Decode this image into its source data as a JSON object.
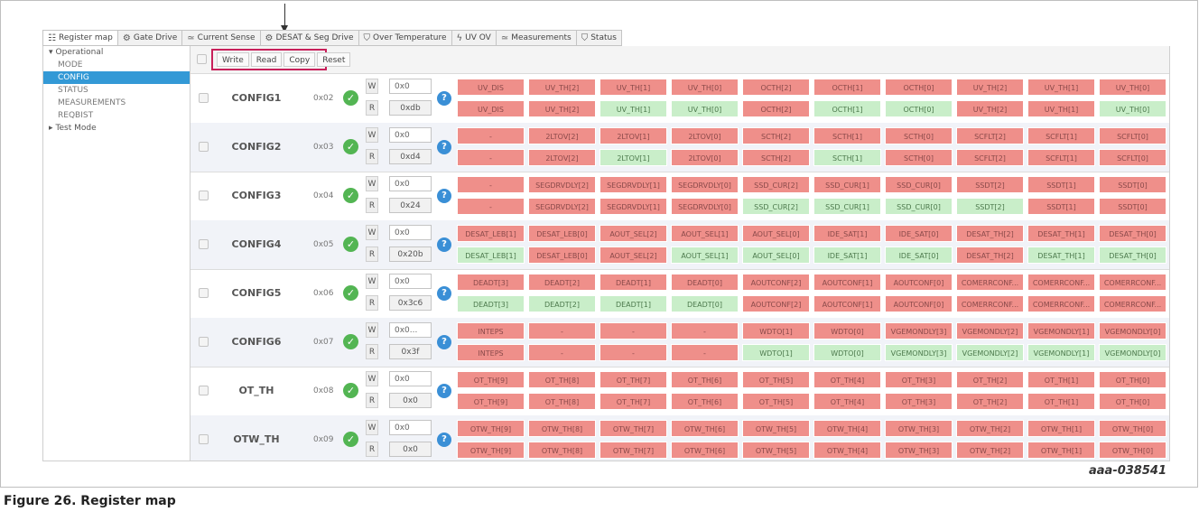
{
  "tabs": [
    {
      "label": "Register map",
      "icon": "register-map-icon",
      "glyph": "☷"
    },
    {
      "label": "Gate Drive",
      "icon": "gear-icon",
      "glyph": "⚙"
    },
    {
      "label": "Current Sense",
      "icon": "chart-icon",
      "glyph": "≃"
    },
    {
      "label": "DESAT & Seg Drive",
      "icon": "gear-icon",
      "glyph": "⚙"
    },
    {
      "label": "Over Temperature",
      "icon": "shield-icon",
      "glyph": "⛉"
    },
    {
      "label": "UV OV",
      "icon": "bolt-icon",
      "glyph": "ϟ"
    },
    {
      "label": "Measurements",
      "icon": "chart-icon",
      "glyph": "≃"
    },
    {
      "label": "Status",
      "icon": "shield-icon",
      "glyph": "⛉"
    }
  ],
  "tree": {
    "groups": [
      {
        "label": "Operational",
        "expanded": true,
        "toggle": "▾",
        "children": [
          {
            "label": "MODE",
            "selected": false
          },
          {
            "label": "CONFIG",
            "selected": true
          },
          {
            "label": "STATUS",
            "selected": false
          },
          {
            "label": "MEASUREMENTS",
            "selected": false
          },
          {
            "label": "REQBIST",
            "selected": false
          }
        ]
      },
      {
        "label": "Test Mode",
        "expanded": false,
        "toggle": "▸",
        "children": []
      }
    ]
  },
  "toolbar": {
    "write": "Write",
    "read": "Read",
    "copy": "Copy",
    "reset": "Reset"
  },
  "labels": {
    "w": "W",
    "r": "R",
    "check_glyph": "✓",
    "help_glyph": "?"
  },
  "registers": [
    {
      "name": "CONFIG1",
      "addr": "0x02",
      "wval": "0x0",
      "rval": "0xdb",
      "bits": [
        "UV_DIS",
        "UV_TH[2]",
        "UV_TH[1]",
        "UV_TH[0]",
        "OCTH[2]",
        "OCTH[1]",
        "OCTH[0]",
        "UV_TH[2]",
        "UV_TH[1]",
        "UV_TH[0]"
      ],
      "rbits": [
        "UV_DIS",
        "UV_TH[2]",
        "UV_TH[1]",
        "UV_TH[0]",
        "OCTH[2]",
        "OCTH[1]",
        "OCTH[0]",
        "UV_TH[2]",
        "UV_TH[1]",
        "UV_TH[0]"
      ],
      "rstate": [
        "red",
        "red",
        "green",
        "green",
        "red",
        "green",
        "green",
        "red",
        "red",
        "green"
      ]
    },
    {
      "name": "CONFIG2",
      "addr": "0x03",
      "wval": "0x0",
      "rval": "0xd4",
      "bits": [
        "-",
        "2LTOV[2]",
        "2LTOV[1]",
        "2LTOV[0]",
        "SCTH[2]",
        "SCTH[1]",
        "SCTH[0]",
        "SCFLT[2]",
        "SCFLT[1]",
        "SCFLT[0]"
      ],
      "rbits": [
        "-",
        "2LTOV[2]",
        "2LTOV[1]",
        "2LTOV[0]",
        "SCTH[2]",
        "SCTH[1]",
        "SCTH[0]",
        "SCFLT[2]",
        "SCFLT[1]",
        "SCFLT[0]"
      ],
      "rstate": [
        "red",
        "red",
        "green",
        "red",
        "red",
        "green",
        "red",
        "red",
        "red",
        "red"
      ]
    },
    {
      "name": "CONFIG3",
      "addr": "0x04",
      "wval": "0x0",
      "rval": "0x24",
      "bits": [
        "-",
        "SEGDRVDLY[2]",
        "SEGDRVDLY[1]",
        "SEGDRVDLY[0]",
        "SSD_CUR[2]",
        "SSD_CUR[1]",
        "SSD_CUR[0]",
        "SSDT[2]",
        "SSDT[1]",
        "SSDT[0]"
      ],
      "rbits": [
        "-",
        "SEGDRVDLY[2]",
        "SEGDRVDLY[1]",
        "SEGDRVDLY[0]",
        "SSD_CUR[2]",
        "SSD_CUR[1]",
        "SSD_CUR[0]",
        "SSDT[2]",
        "SSDT[1]",
        "SSDT[0]"
      ],
      "rstate": [
        "red",
        "red",
        "red",
        "red",
        "green",
        "green",
        "green",
        "green",
        "red",
        "red"
      ]
    },
    {
      "name": "CONFIG4",
      "addr": "0x05",
      "wval": "0x0",
      "rval": "0x20b",
      "bits": [
        "DESAT_LEB[1]",
        "DESAT_LEB[0]",
        "AOUT_SEL[2]",
        "AOUT_SEL[1]",
        "AOUT_SEL[0]",
        "IDE_SAT[1]",
        "IDE_SAT[0]",
        "DESAT_TH[2]",
        "DESAT_TH[1]",
        "DESAT_TH[0]"
      ],
      "rbits": [
        "DESAT_LEB[1]",
        "DESAT_LEB[0]",
        "AOUT_SEL[2]",
        "AOUT_SEL[1]",
        "AOUT_SEL[0]",
        "IDE_SAT[1]",
        "IDE_SAT[0]",
        "DESAT_TH[2]",
        "DESAT_TH[1]",
        "DESAT_TH[0]"
      ],
      "rstate": [
        "green",
        "red",
        "red",
        "green",
        "green",
        "green",
        "green",
        "red",
        "green",
        "green"
      ]
    },
    {
      "name": "CONFIG5",
      "addr": "0x06",
      "wval": "0x0",
      "rval": "0x3c6",
      "bits": [
        "DEADT[3]",
        "DEADT[2]",
        "DEADT[1]",
        "DEADT[0]",
        "AOUTCONF[2]",
        "AOUTCONF[1]",
        "AOUTCONF[0]",
        "COMERRCONF...",
        "COMERRCONF...",
        "COMERRCONF..."
      ],
      "rbits": [
        "DEADT[3]",
        "DEADT[2]",
        "DEADT[1]",
        "DEADT[0]",
        "AOUTCONF[2]",
        "AOUTCONF[1]",
        "AOUTCONF[0]",
        "COMERRCONF...",
        "COMERRCONF...",
        "COMERRCONF..."
      ],
      "rstate": [
        "green",
        "green",
        "green",
        "green",
        "red",
        "red",
        "red",
        "red",
        "red",
        "red"
      ]
    },
    {
      "name": "CONFIG6",
      "addr": "0x07",
      "wval": "0x0...",
      "rval": "0x3f",
      "bits": [
        "INTEPS",
        "-",
        "-",
        "-",
        "WDTO[1]",
        "WDTO[0]",
        "VGEMONDLY[3]",
        "VGEMONDLY[2]",
        "VGEMONDLY[1]",
        "VGEMONDLY[0]"
      ],
      "rbits": [
        "INTEPS",
        "-",
        "-",
        "-",
        "WDTO[1]",
        "WDTO[0]",
        "VGEMONDLY[3]",
        "VGEMONDLY[2]",
        "VGEMONDLY[1]",
        "VGEMONDLY[0]"
      ],
      "rstate": [
        "red",
        "red",
        "red",
        "red",
        "green",
        "green",
        "green",
        "green",
        "green",
        "green"
      ]
    },
    {
      "name": "OT_TH",
      "addr": "0x08",
      "wval": "0x0",
      "rval": "0x0",
      "bits": [
        "OT_TH[9]",
        "OT_TH[8]",
        "OT_TH[7]",
        "OT_TH[6]",
        "OT_TH[5]",
        "OT_TH[4]",
        "OT_TH[3]",
        "OT_TH[2]",
        "OT_TH[1]",
        "OT_TH[0]"
      ],
      "rbits": [
        "OT_TH[9]",
        "OT_TH[8]",
        "OT_TH[7]",
        "OT_TH[6]",
        "OT_TH[5]",
        "OT_TH[4]",
        "OT_TH[3]",
        "OT_TH[2]",
        "OT_TH[1]",
        "OT_TH[0]"
      ],
      "rstate": [
        "red",
        "red",
        "red",
        "red",
        "red",
        "red",
        "red",
        "red",
        "red",
        "red"
      ]
    },
    {
      "name": "OTW_TH",
      "addr": "0x09",
      "wval": "0x0",
      "rval": "0x0",
      "bits": [
        "OTW_TH[9]",
        "OTW_TH[8]",
        "OTW_TH[7]",
        "OTW_TH[6]",
        "OTW_TH[5]",
        "OTW_TH[4]",
        "OTW_TH[3]",
        "OTW_TH[2]",
        "OTW_TH[1]",
        "OTW_TH[0]"
      ],
      "rbits": [
        "OTW_TH[9]",
        "OTW_TH[8]",
        "OTW_TH[7]",
        "OTW_TH[6]",
        "OTW_TH[5]",
        "OTW_TH[4]",
        "OTW_TH[3]",
        "OTW_TH[2]",
        "OTW_TH[1]",
        "OTW_TH[0]"
      ],
      "rstate": [
        "red",
        "red",
        "red",
        "red",
        "red",
        "red",
        "red",
        "red",
        "red",
        "red"
      ]
    }
  ],
  "figure": {
    "code": "aaa-038541",
    "caption": "Figure 26.  Register map"
  },
  "colors": {
    "accent": "#3399d6",
    "highlight_border": "#c8205a",
    "bit_red": "#ef8f8a",
    "bit_green": "#c9eec9",
    "ok_green": "#53b553"
  }
}
